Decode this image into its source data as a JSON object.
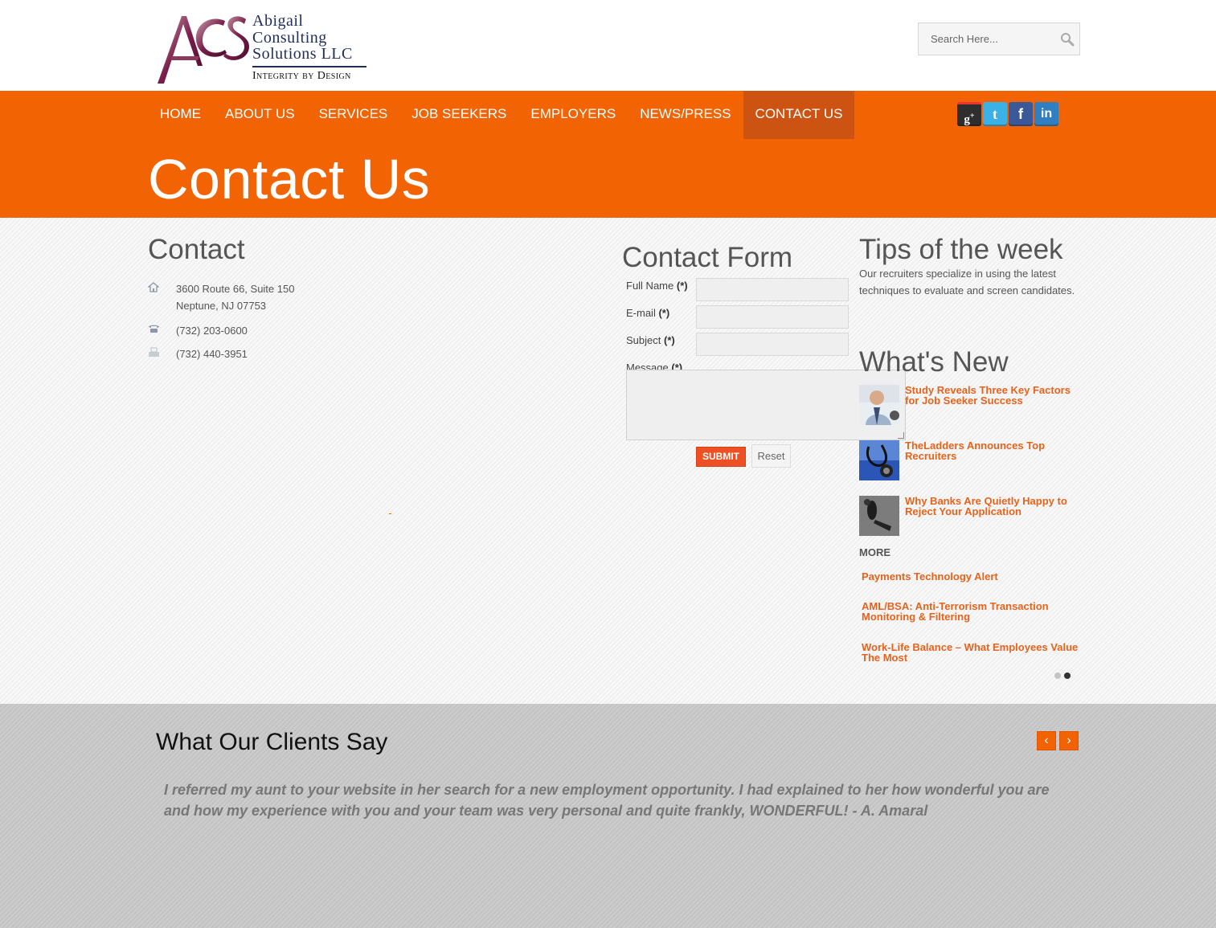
{
  "header": {
    "logo_line1": "Abigail",
    "logo_line2": "Consulting",
    "logo_line3": "Solutions LLC",
    "logo_tagline": "Integrity by Design",
    "search_placeholder": "Search Here..."
  },
  "nav": {
    "items": [
      "HOME",
      "ABOUT US",
      "SERVICES",
      "JOB SEEKERS",
      "EMPLOYERS",
      "NEWS/PRESS",
      "CONTACT US"
    ],
    "active": "CONTACT US"
  },
  "social": {
    "icons": [
      "google-plus-icon",
      "twitter-icon",
      "facebook-icon",
      "linkedin-icon"
    ]
  },
  "page_title": "Contact Us",
  "contact": {
    "title": "Contact",
    "address_line1": "3600 Route 66, Suite 150",
    "address_line2": "Neptune, NJ 07753",
    "phone": "(732) 203-0600",
    "fax": "(732) 440-3951"
  },
  "form": {
    "title": "Contact Form",
    "full_name_label": "Full Name",
    "email_label": "E-mail",
    "subject_label": "Subject",
    "message_label": "Message",
    "required_mark": "(*)",
    "submit_label": "SUBMIT",
    "reset_label": "Reset"
  },
  "tips": {
    "title": "Tips of the week",
    "text": "Our recruiters specialize in using the latest techniques to evaluate and screen candidates."
  },
  "whats_new": {
    "title": "What's New",
    "items": [
      "Study Reveals Three Key Factors for Job Seeker Success",
      "TheLadders Announces Top Recruiters",
      "Why Banks Are Quietly Happy to Reject Your Application"
    ],
    "more_label": "MORE",
    "more_items": [
      "Payments Technology Alert",
      "AML/BSA: Anti-Terrorism Transaction Monitoring & Filtering",
      "Work-Life Balance – What Employees Value The Most"
    ]
  },
  "testimonials": {
    "title": "What Our Clients Say",
    "quote": "I referred my aunt to your website in her search for a new employment opportunity. I had explained to her how wonderful you are and how my experience with you and your team was very personal and quite frankly, WONDERFUL!  - A. Amaral",
    "prev_glyph": "‹",
    "next_glyph": "›"
  },
  "colors": {
    "brand_orange": "#f26304",
    "active_nav": "#cc5311",
    "link_orange": "#e8621b",
    "submit_red": "#ee4f23"
  }
}
